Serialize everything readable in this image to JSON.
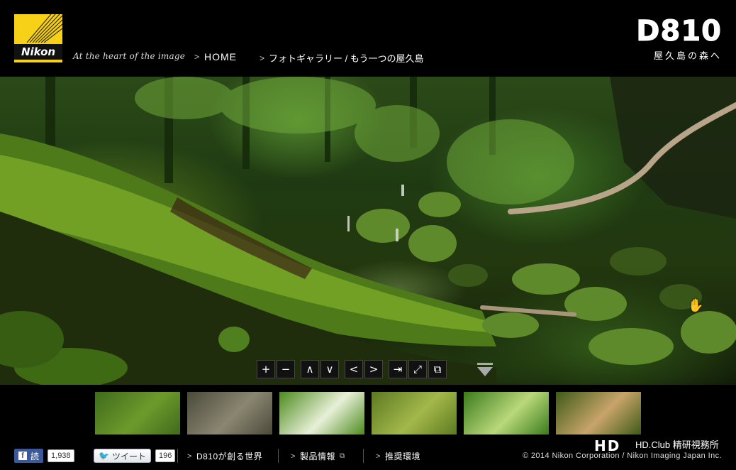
{
  "header": {
    "logo_word": "Nikon",
    "tagline": "At the heart of the image",
    "nav": [
      {
        "label": "HOME"
      },
      {
        "label": "フォトギャラリー / もう一つの屋久島"
      }
    ],
    "brand_model": "D810",
    "brand_subtitle": "屋久島の森へ"
  },
  "controls": [
    {
      "icon": "zoom-in-icon",
      "glyph": "+"
    },
    {
      "icon": "zoom-out-icon",
      "glyph": "−"
    },
    {
      "icon": "up-icon",
      "glyph": "∧"
    },
    {
      "icon": "down-icon",
      "glyph": "∨"
    },
    {
      "icon": "left-icon",
      "glyph": "<"
    },
    {
      "icon": "right-icon",
      "glyph": ">"
    },
    {
      "icon": "enter-icon",
      "glyph": "⇥"
    },
    {
      "icon": "fullscreen-icon",
      "glyph": "⤢"
    },
    {
      "icon": "window-icon",
      "glyph": "⧉"
    }
  ],
  "thumbnails": [
    {
      "name": "thumb-ferns",
      "colors": [
        "#3f6b1c",
        "#6e9a2c"
      ]
    },
    {
      "name": "thumb-stones",
      "colors": [
        "#4a4a3a",
        "#8b8672"
      ]
    },
    {
      "name": "thumb-leaves",
      "colors": [
        "#4d8a1e",
        "#e8f0d8"
      ]
    },
    {
      "name": "thumb-moss",
      "colors": [
        "#5d7a22",
        "#a3b84a"
      ]
    },
    {
      "name": "thumb-sprout",
      "colors": [
        "#3a7b1c",
        "#b9d87a"
      ]
    },
    {
      "name": "thumb-bark",
      "colors": [
        "#3d5a17",
        "#c9a46a"
      ]
    }
  ],
  "footer": {
    "facebook_label": "読",
    "facebook_count": "1,938",
    "tweet_label": "ツイート",
    "tweet_count": "196",
    "links": [
      {
        "label": "D810が創る世界"
      },
      {
        "label": "製品情報"
      },
      {
        "label": "推奨環境"
      }
    ],
    "copyright": "© 2014 Nikon Corporation / Nikon Imaging Japan Inc."
  },
  "watermark": {
    "hd": "HD",
    "club": "HD.Club 精研視務所"
  },
  "colors": {
    "nikon_yellow": "#f7d117",
    "facebook_blue": "#3b5998",
    "twitter_blue": "#2aa9e0"
  }
}
